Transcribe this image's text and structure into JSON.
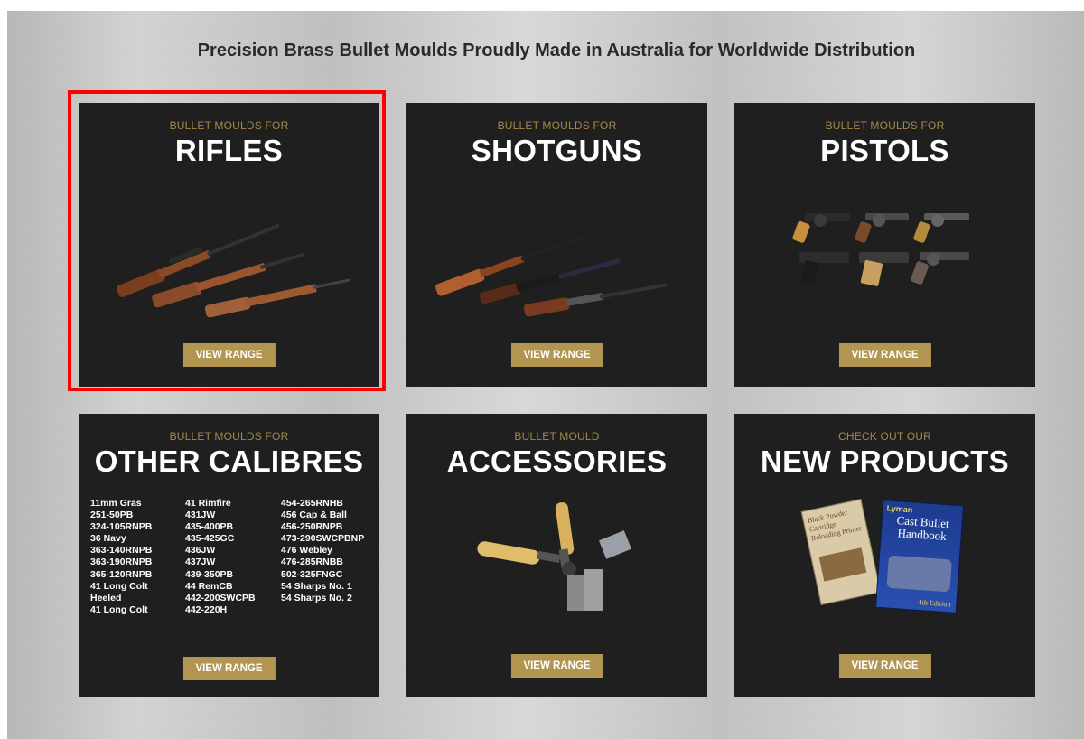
{
  "headline": "Precision Brass Bullet Moulds Proudly Made in Australia for Worldwide Distribution",
  "colors": {
    "gold": "#b39552",
    "eyebrow_gold": "#a8884a",
    "card_bg": "#1f1f1f",
    "highlight": "#ff0000"
  },
  "cards": [
    {
      "eyebrow": "BULLET MOULDS FOR",
      "title": "RIFLES",
      "button": "VIEW RANGE",
      "icon": "rifles-image",
      "highlighted": true
    },
    {
      "eyebrow": "BULLET MOULDS FOR",
      "title": "SHOTGUNS",
      "button": "VIEW RANGE",
      "icon": "shotguns-image"
    },
    {
      "eyebrow": "BULLET MOULDS FOR",
      "title": "PISTOLS",
      "button": "VIEW RANGE",
      "icon": "pistols-image"
    },
    {
      "eyebrow": "BULLET MOULDS FOR",
      "title": "OTHER CALIBRES",
      "button": "VIEW RANGE",
      "calibres": [
        [
          "11mm Gras",
          "251-50PB",
          "324-105RNPB",
          "36 Navy",
          "363-140RNPB",
          "363-190RNPB",
          "365-120RNPB",
          "41 Long Colt",
          "Heeled",
          "41 Long Colt"
        ],
        [
          "41 Rimfire",
          "431JW",
          "435-400PB",
          "435-425GC",
          "436JW",
          "437JW",
          "439-350PB",
          "44 RemCB",
          "442-200SWCPB",
          "442-220H"
        ],
        [
          "454-265RNHB",
          "456 Cap & Ball",
          "456-250RNPB",
          "473-290SWCPBNP",
          "476 Webley",
          "476-285RNBB",
          "502-325FNGC",
          "54 Sharps No. 1",
          "54 Sharps No. 2"
        ]
      ]
    },
    {
      "eyebrow": "BULLET MOULD",
      "title": "ACCESSORIES",
      "button": "VIEW RANGE",
      "icon": "mould-tool-image"
    },
    {
      "eyebrow": "CHECK OUT OUR",
      "title": "NEW PRODUCTS",
      "button": "VIEW RANGE",
      "icon": "books-image",
      "book_titles": [
        "Lyman",
        "Cast Bullet Handbook",
        "4th Edition",
        "Black Powder Cartridge Reloading Primer"
      ]
    }
  ]
}
